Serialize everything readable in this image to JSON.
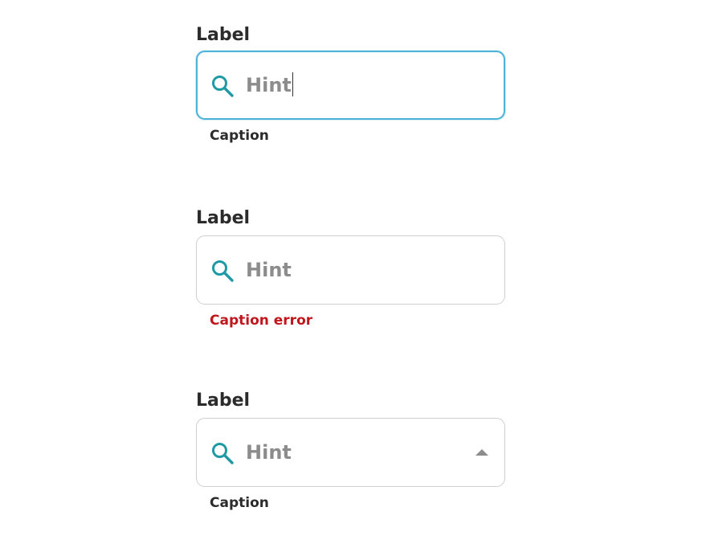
{
  "fields": [
    {
      "label": "Label",
      "hint": "Hint",
      "caption": "Caption",
      "state": "focused"
    },
    {
      "label": "Label",
      "hint": "Hint",
      "caption": "Caption error",
      "state": "error"
    },
    {
      "label": "Label",
      "hint": "Hint",
      "caption": "Caption",
      "state": "dropdown"
    }
  ],
  "icons": {
    "search": "search-icon",
    "dropdown": "chevron-up-icon"
  },
  "colors": {
    "accent": "#1f9aa5",
    "focus_border": "#4fb3d9",
    "border": "#cfcfcf",
    "hint_text": "#8c8c8c",
    "label_text": "#2b2b2b",
    "error_text": "#c0171c"
  }
}
